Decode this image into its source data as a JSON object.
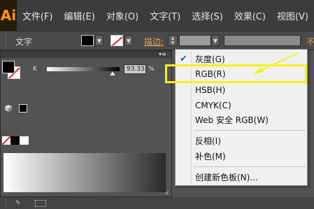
{
  "app": {
    "logo": "Ai"
  },
  "menubar": {
    "items": [
      "文件(F)",
      "编辑(E)",
      "对象(O)",
      "文字(T)",
      "选择(S)",
      "效果(C)",
      "视图(V)"
    ]
  },
  "controlbar": {
    "label": "文字",
    "stroke_label": "描边:",
    "opacity_label": "不"
  },
  "color_panel": {
    "channel_label": "K",
    "channel_value": "93.33",
    "channel_unit": "%",
    "k_level_percent": 93.33,
    "fill_color": "#000000",
    "stroke": "none"
  },
  "dropdown": {
    "checked_index": 0,
    "items": [
      "灰度(G)",
      "RGB(R)",
      "HSB(H)",
      "CMYK(C)",
      "Web 安全 RGB(W)",
      "反相(I)",
      "补色(M)",
      "创建新色板(N)..."
    ]
  },
  "annotation": {
    "highlight_color": "#f2f21c",
    "highlighted_item": "RGB(R)"
  }
}
